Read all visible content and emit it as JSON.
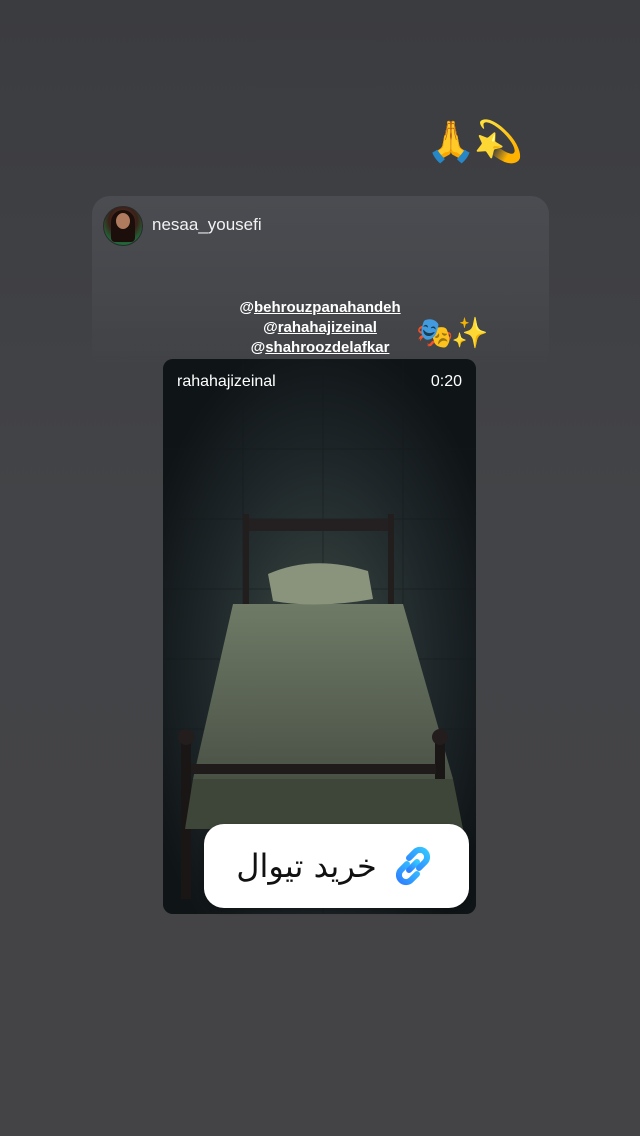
{
  "story": {
    "top_emoji": "🙏💫",
    "card": {
      "username": "nesaa_yousefi",
      "mentions": [
        "behrouzpanahandeh",
        "rahahajizeinal",
        "shahroozdelafkar"
      ],
      "mention_prefix": "@",
      "emoji": "🎭✨"
    },
    "media": {
      "username": "rahahajizeinal",
      "duration": "0:20"
    },
    "link_sticker": {
      "label": "خرید تیوال",
      "icon": "link-icon"
    }
  }
}
